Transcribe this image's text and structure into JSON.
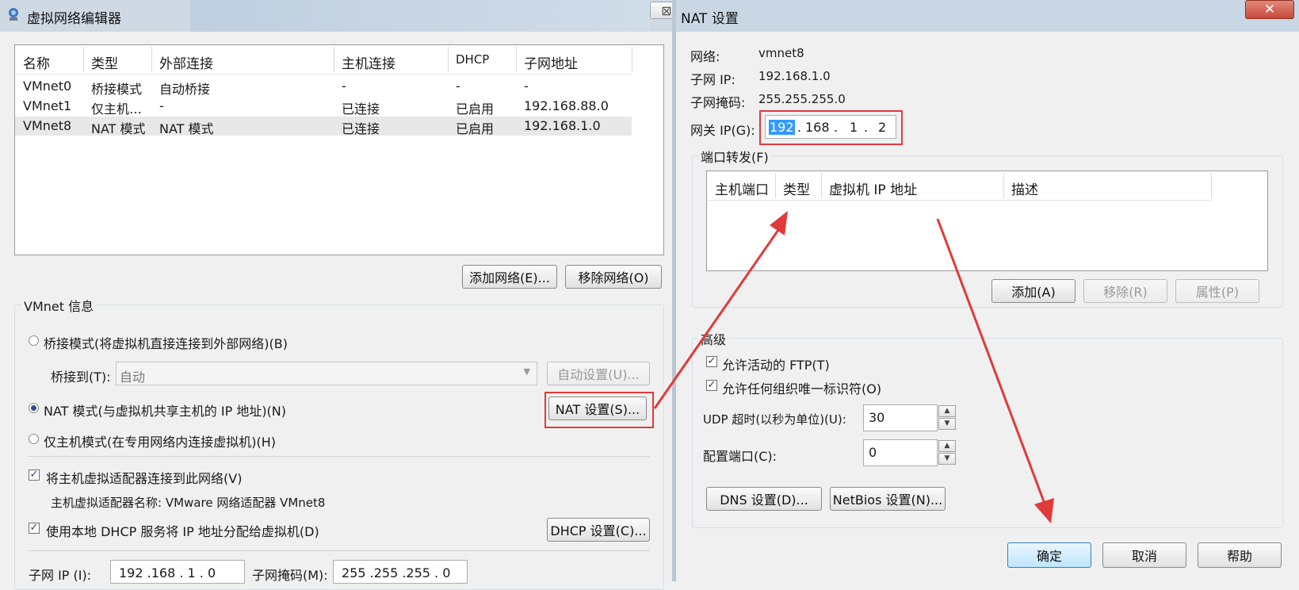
{
  "vne": {
    "title": "虚拟网络编辑器",
    "columns": [
      "名称",
      "类型",
      "外部连接",
      "主机连接",
      "DHCP",
      "子网地址"
    ],
    "rows": [
      [
        "VMnet0",
        "桥接模式",
        "自动桥接",
        "-",
        "-",
        "-"
      ],
      [
        "VMnet1",
        "仅主机…",
        "-",
        "已连接",
        "已启用",
        "192.168.88.0"
      ],
      [
        "VMnet8",
        "NAT 模式",
        "NAT 模式",
        "已连接",
        "已启用",
        "192.168.1.0"
      ]
    ],
    "add_network": "添加网络(E)...",
    "remove_network": "移除网络(O)",
    "info_group": "VMnet 信息",
    "bridge_mode": "桥接模式(将虚拟机直接连接到外部网络)(B)",
    "bridge_to_label": "桥接到(T):",
    "bridge_to_value": "自动",
    "auto_settings": "自动设置(U)...",
    "nat_mode": "NAT 模式(与虚拟机共享主机的 IP 地址)(N)",
    "nat_settings": "NAT 设置(S)...",
    "host_only": "仅主机模式(在专用网络内连接虚拟机)(H)",
    "connect_adapter": "将主机虚拟适配器连接到此网络(V)",
    "adapter_name": "主机虚拟适配器名称: VMware 网络适配器 VMnet8",
    "use_dhcp": "使用本地 DHCP 服务将 IP 地址分配给虚拟机(D)",
    "dhcp_settings": "DHCP 设置(C)...",
    "subnet_ip_label": "子网 IP (I):",
    "subnet_ip_value": "192 .168 . 1 . 0",
    "subnet_mask_label": "子网掩码(M):",
    "subnet_mask_value": "255 .255 .255 . 0",
    "close_glyph": "⊠"
  },
  "nat": {
    "title": "NAT 设置",
    "network_label": "网络:",
    "network_value": "vmnet8",
    "subnet_ip_label": "子网 IP:",
    "subnet_ip_value": "192.168.1.0",
    "subnet_mask_label": "子网掩码:",
    "subnet_mask_value": "255.255.255.0",
    "gateway_label": "网关 IP(G):",
    "gateway_octets": [
      "192",
      "168",
      "1",
      "2"
    ],
    "port_forward_label": "端口转发(F)",
    "pf_columns": [
      "主机端口",
      "类型",
      "虚拟机 IP 地址",
      "描述"
    ],
    "add": "添加(A)",
    "remove": "移除(R)",
    "properties": "属性(P)",
    "advanced": "高级",
    "allow_ftp": "允许活动的 FTP(T)",
    "allow_uid": "允许任何组织唯一标识符(O)",
    "udp_label": "UDP 超时(以秒为单位)(U):",
    "udp_value": "30",
    "config_port_label": "配置端口(C):",
    "config_port_value": "0",
    "dns": "DNS 设置(D)...",
    "netbios": "NetBios 设置(N)...",
    "ok": "确定",
    "cancel": "取消",
    "help": "帮助",
    "close_glyph": "✕"
  },
  "colors": {
    "close_red": "#c94a3a",
    "annotation_red": "#e03a3a",
    "selection_blue": "#3399ff"
  }
}
